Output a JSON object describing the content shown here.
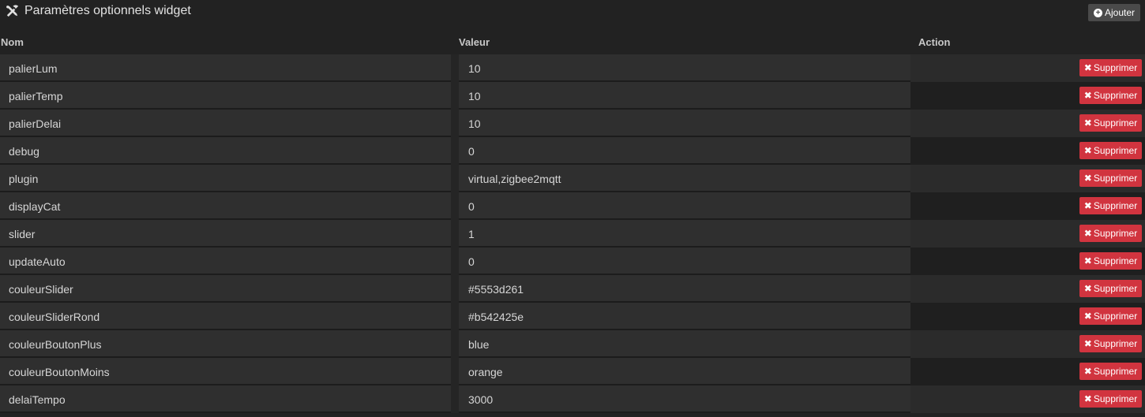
{
  "title": "Paramètres optionnels widget",
  "add_button": {
    "label": "Ajouter",
    "icon": "plus-circle-icon"
  },
  "table": {
    "headers": {
      "name": "Nom",
      "value": "Valeur",
      "action": "Action"
    },
    "delete_label": "Supprimer",
    "rows": [
      {
        "name": "palierLum",
        "value": "10"
      },
      {
        "name": "palierTemp",
        "value": "10"
      },
      {
        "name": "palierDelai",
        "value": "10"
      },
      {
        "name": "debug",
        "value": "0"
      },
      {
        "name": "plugin",
        "value": "virtual,zigbee2mqtt"
      },
      {
        "name": "displayCat",
        "value": "0"
      },
      {
        "name": "slider",
        "value": "1"
      },
      {
        "name": "updateAuto",
        "value": "0"
      },
      {
        "name": "couleurSlider",
        "value": "#5553d261"
      },
      {
        "name": "couleurSliderRond",
        "value": "#b542425e"
      },
      {
        "name": "couleurBoutonPlus",
        "value": "blue"
      },
      {
        "name": "couleurBoutonMoins",
        "value": "orange"
      },
      {
        "name": "delaiTempo",
        "value": "3000"
      }
    ]
  },
  "colors": {
    "background": "#222222",
    "delete_button": "#d1343f",
    "add_button": "#4a4a4a"
  }
}
